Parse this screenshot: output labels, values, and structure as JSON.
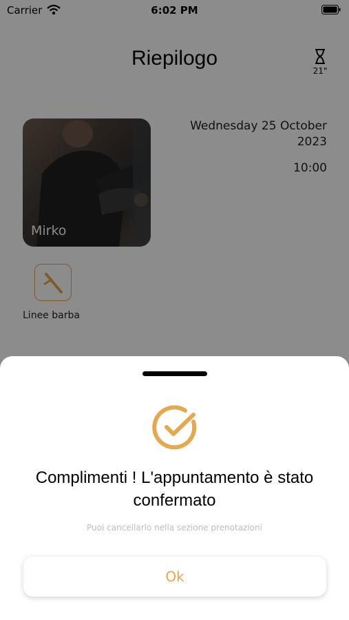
{
  "status_bar": {
    "carrier": "Carrier",
    "time": "6:02 PM"
  },
  "header": {
    "title": "Riepilogo",
    "timer_label": "21\""
  },
  "barber": {
    "name": "Mirko"
  },
  "appointment": {
    "date": "Wednesday 25 October 2023",
    "time": "10:00"
  },
  "service": {
    "label": "Linee barba",
    "icon": "razor-icon"
  },
  "dialog": {
    "message": "Complimenti ! L'appuntamento è stato confermato",
    "subtitle": "Puoi cancellarlo nella sezione prenotazioni",
    "ok_label": "Ok",
    "icon": "check-circle-icon"
  },
  "colors": {
    "accent": "#E3A850"
  }
}
